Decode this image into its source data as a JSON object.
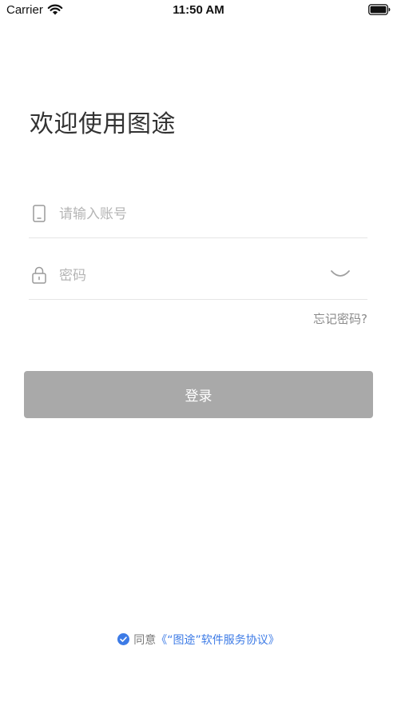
{
  "status_bar": {
    "carrier": "Carrier",
    "time": "11:50 AM"
  },
  "title": "欢迎使用图途",
  "account": {
    "placeholder": "请输入账号",
    "value": "",
    "icon": "phone-icon"
  },
  "password": {
    "placeholder": "密码",
    "value": "",
    "icon": "lock-icon",
    "toggle_icon": "eye-closed-icon"
  },
  "forgot_password": "忘记密码?",
  "login_button": "登录",
  "agreement": {
    "checked": true,
    "prefix": "同意",
    "link": "《“图途”软件服务协议》"
  },
  "colors": {
    "button_bg": "#a9a9a9",
    "link": "#3d7be6",
    "placeholder": "#b5b5b5",
    "divider": "#e6e6e6"
  }
}
